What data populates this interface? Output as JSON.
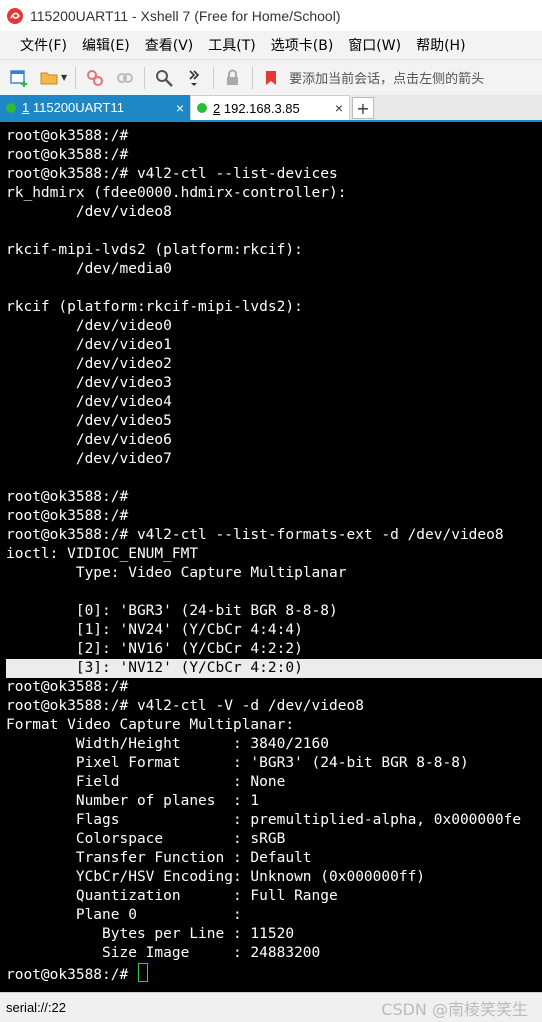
{
  "window": {
    "title": "115200UART11 - Xshell 7 (Free for Home/School)"
  },
  "menu": [
    {
      "label": "文件(F)"
    },
    {
      "label": "编辑(E)"
    },
    {
      "label": "查看(V)"
    },
    {
      "label": "工具(T)"
    },
    {
      "label": "选项卡(B)"
    },
    {
      "label": "窗口(W)"
    },
    {
      "label": "帮助(H)"
    }
  ],
  "toolbar": {
    "hint": "要添加当前会话，点击左侧的箭头"
  },
  "tabs": [
    {
      "num": "1",
      "label": "115200UART11",
      "close": "×"
    },
    {
      "num": "2",
      "label": "192.168.3.85",
      "close": "×"
    }
  ],
  "tab_add": "+",
  "terminal": {
    "lines": [
      "root@ok3588:/#",
      "root@ok3588:/#",
      "root@ok3588:/# v4l2-ctl --list-devices",
      "rk_hdmirx (fdee0000.hdmirx-controller):",
      "        /dev/video8",
      "",
      "rkcif-mipi-lvds2 (platform:rkcif):",
      "        /dev/media0",
      "",
      "rkcif (platform:rkcif-mipi-lvds2):",
      "        /dev/video0",
      "        /dev/video1",
      "        /dev/video2",
      "        /dev/video3",
      "        /dev/video4",
      "        /dev/video5",
      "        /dev/video6",
      "        /dev/video7",
      "",
      "root@ok3588:/#",
      "root@ok3588:/#",
      "root@ok3588:/# v4l2-ctl --list-formats-ext -d /dev/video8",
      "ioctl: VIDIOC_ENUM_FMT",
      "        Type: Video Capture Multiplanar",
      "",
      "        [0]: 'BGR3' (24-bit BGR 8-8-8)",
      "        [1]: 'NV24' (Y/CbCr 4:4:4)",
      "        [2]: 'NV16' (Y/CbCr 4:2:2)",
      "        [3]: 'NV12' (Y/CbCr 4:2:0)",
      "root@ok3588:/#",
      "root@ok3588:/# v4l2-ctl -V -d /dev/video8",
      "Format Video Capture Multiplanar:",
      "        Width/Height      : 3840/2160",
      "        Pixel Format      : 'BGR3' (24-bit BGR 8-8-8)",
      "        Field             : None",
      "        Number of planes  : 1",
      "        Flags             : premultiplied-alpha, 0x000000fe",
      "        Colorspace        : sRGB",
      "        Transfer Function : Default",
      "        YCbCr/HSV Encoding: Unknown (0x000000ff)",
      "        Quantization      : Full Range",
      "        Plane 0           :",
      "           Bytes per Line : 11520",
      "           Size Image     : 24883200"
    ],
    "prompt": "root@ok3588:/# ",
    "highlighted_line": "        [3]: 'NV12' (Y/CbCr 4:2:0)"
  },
  "status": {
    "connection": "serial://:22",
    "watermark": "CSDN @南棱笑笑生"
  },
  "colors": {
    "accent": "#1e88c7",
    "terminal_bg": "#000000",
    "terminal_fg": "#ffffff",
    "cursor": "#2bd435",
    "connected_dot": "#2bbd3a"
  }
}
